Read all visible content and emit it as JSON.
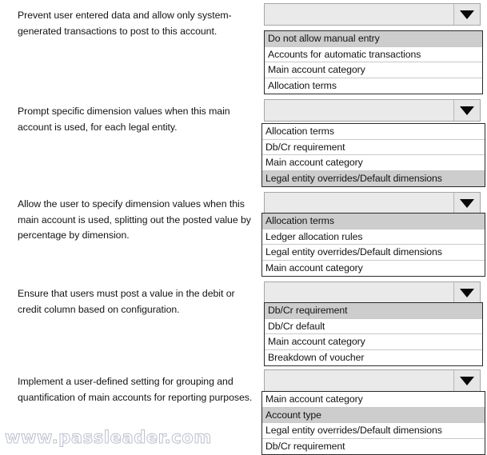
{
  "page": {
    "watermark": "www.passleader.com",
    "icons": {
      "dropdown_arrow": "chevron-down-icon"
    },
    "colors": {
      "option_selected_bg": "#cdcdcd",
      "option_bg": "#ffffff",
      "combo_bg": "#e9e9e9",
      "list_border": "#2b2b2b",
      "text": "#141414"
    }
  },
  "groups": [
    {
      "id": "group-1",
      "prompt": "Prevent user entered data and allow only system-generated transactions to post to this account.",
      "combo_value": "",
      "options": [
        {
          "label": "Do not allow manual entry",
          "selected": true
        },
        {
          "label": "Accounts for automatic transactions",
          "selected": false
        },
        {
          "label": "Main account category",
          "selected": false
        },
        {
          "label": "Allocation terms",
          "selected": false
        }
      ]
    },
    {
      "id": "group-2",
      "prompt": "Prompt specific dimension values when this main account is used, for each legal entity.",
      "combo_value": "",
      "options": [
        {
          "label": "Allocation terms",
          "selected": false
        },
        {
          "label": "Db/Cr requirement",
          "selected": false
        },
        {
          "label": "Main account category",
          "selected": false
        },
        {
          "label": "Legal entity overrides/Default dimensions",
          "selected": true
        }
      ]
    },
    {
      "id": "group-3",
      "prompt": "Allow the user to specify dimension values when this main account is used, splitting out the posted value by percentage by dimension.",
      "combo_value": "",
      "options": [
        {
          "label": "Allocation terms",
          "selected": true
        },
        {
          "label": "Ledger allocation rules",
          "selected": false
        },
        {
          "label": "Legal entity overrides/Default dimensions",
          "selected": false
        },
        {
          "label": "Main account category",
          "selected": false
        }
      ]
    },
    {
      "id": "group-4",
      "prompt": "Ensure that users must post a value in the debit or credit column based on configuration.",
      "combo_value": "",
      "options": [
        {
          "label": "Db/Cr requirement",
          "selected": true
        },
        {
          "label": "Db/Cr default",
          "selected": false
        },
        {
          "label": "Main account category",
          "selected": false
        },
        {
          "label": "Breakdown of voucher",
          "selected": false
        }
      ]
    },
    {
      "id": "group-5",
      "prompt": "Implement a user-defined setting for grouping and quantification of main accounts for reporting purposes.",
      "combo_value": "",
      "options": [
        {
          "label": "Main account category",
          "selected": false
        },
        {
          "label": "Account type",
          "selected": true
        },
        {
          "label": "Legal entity overrides/Default dimensions",
          "selected": false
        },
        {
          "label": "Db/Cr requirement",
          "selected": false
        }
      ]
    }
  ]
}
